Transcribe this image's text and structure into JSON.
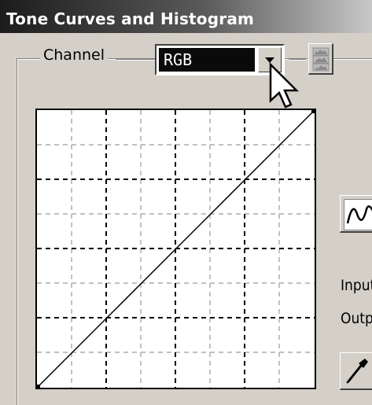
{
  "window": {
    "title": "Tone Curves and Histogram"
  },
  "channel": {
    "label": "Channel",
    "selected": "RGB"
  },
  "side_labels": {
    "input": "Input",
    "output": "Output"
  },
  "icons": {
    "dropdown_arrow": "chevron-down-icon",
    "histogram": "histogram-icon",
    "curve": "curve-icon",
    "eyedropper": "eyedropper-icon",
    "cursor": "mouse-pointer-icon"
  },
  "colors": {
    "title_gradient_start": "#1c1c1c",
    "dialog_background": "#d4d0c8",
    "selection": "#0a0a0a"
  }
}
